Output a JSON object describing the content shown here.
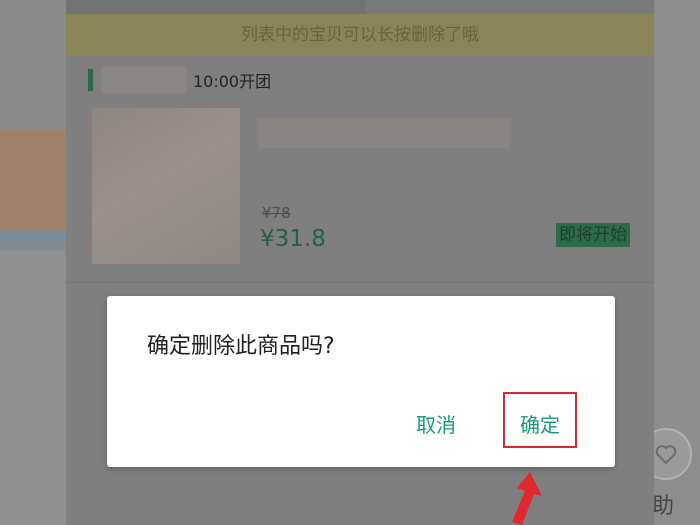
{
  "tip_banner": "列表中的宝贝可以长按删除了哦",
  "product": {
    "start_time": "10:00开团",
    "original_price": "¥78",
    "current_price": "¥31.8",
    "status_badge": "即将开始"
  },
  "dialog": {
    "message": "确定删除此商品吗?",
    "cancel_label": "取消",
    "confirm_label": "确定"
  },
  "side": {
    "help_label": "助"
  },
  "colors": {
    "accent_green": "#1b9a76",
    "highlight_red": "#d9272e"
  }
}
